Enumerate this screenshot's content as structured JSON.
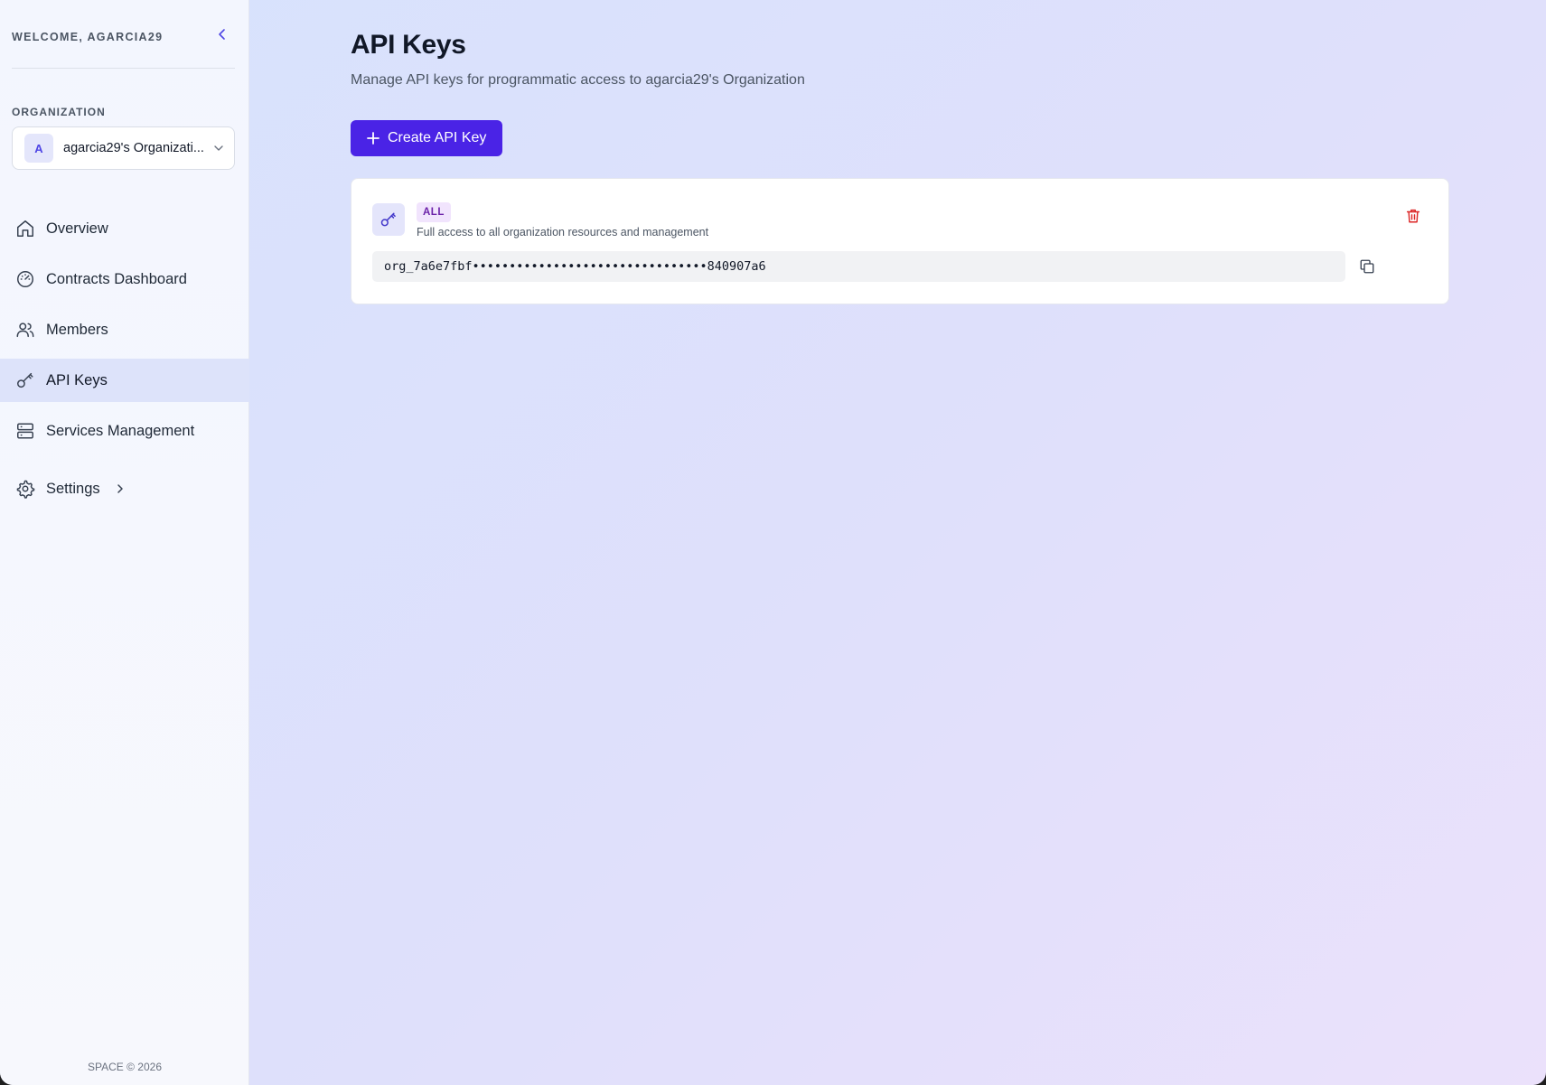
{
  "sidebar": {
    "welcome": "WELCOME, AGARCIA29",
    "organization_label": "ORGANIZATION",
    "organization": {
      "avatar_letter": "A",
      "name": "agarcia29's Organizati..."
    },
    "nav": [
      {
        "label": "Overview",
        "icon": "home-icon",
        "active": false
      },
      {
        "label": "Contracts Dashboard",
        "icon": "gauge-icon",
        "active": false
      },
      {
        "label": "Members",
        "icon": "users-icon",
        "active": false
      },
      {
        "label": "API Keys",
        "icon": "key-icon",
        "active": true
      },
      {
        "label": "Services Management",
        "icon": "server-icon",
        "active": false
      },
      {
        "label": "Settings",
        "icon": "gear-icon",
        "active": false,
        "has_submenu": true
      }
    ],
    "footer": "SPACE © 2026"
  },
  "main": {
    "title": "API Keys",
    "subtitle": "Manage API keys for programmatic access to agarcia29's Organization",
    "create_button_label": "Create API Key",
    "keys": [
      {
        "scope": "ALL",
        "description": "Full access to all organization resources and management",
        "masked_key": "org_7a6e7fbf••••••••••••••••••••••••••••••••840907a6"
      }
    ]
  },
  "colors": {
    "accent": "#4a23e6",
    "active_nav_bg": "#dde3fa",
    "badge_bg": "#f1e4fd",
    "badge_text": "#6b21a8",
    "delete": "#dc2626"
  }
}
